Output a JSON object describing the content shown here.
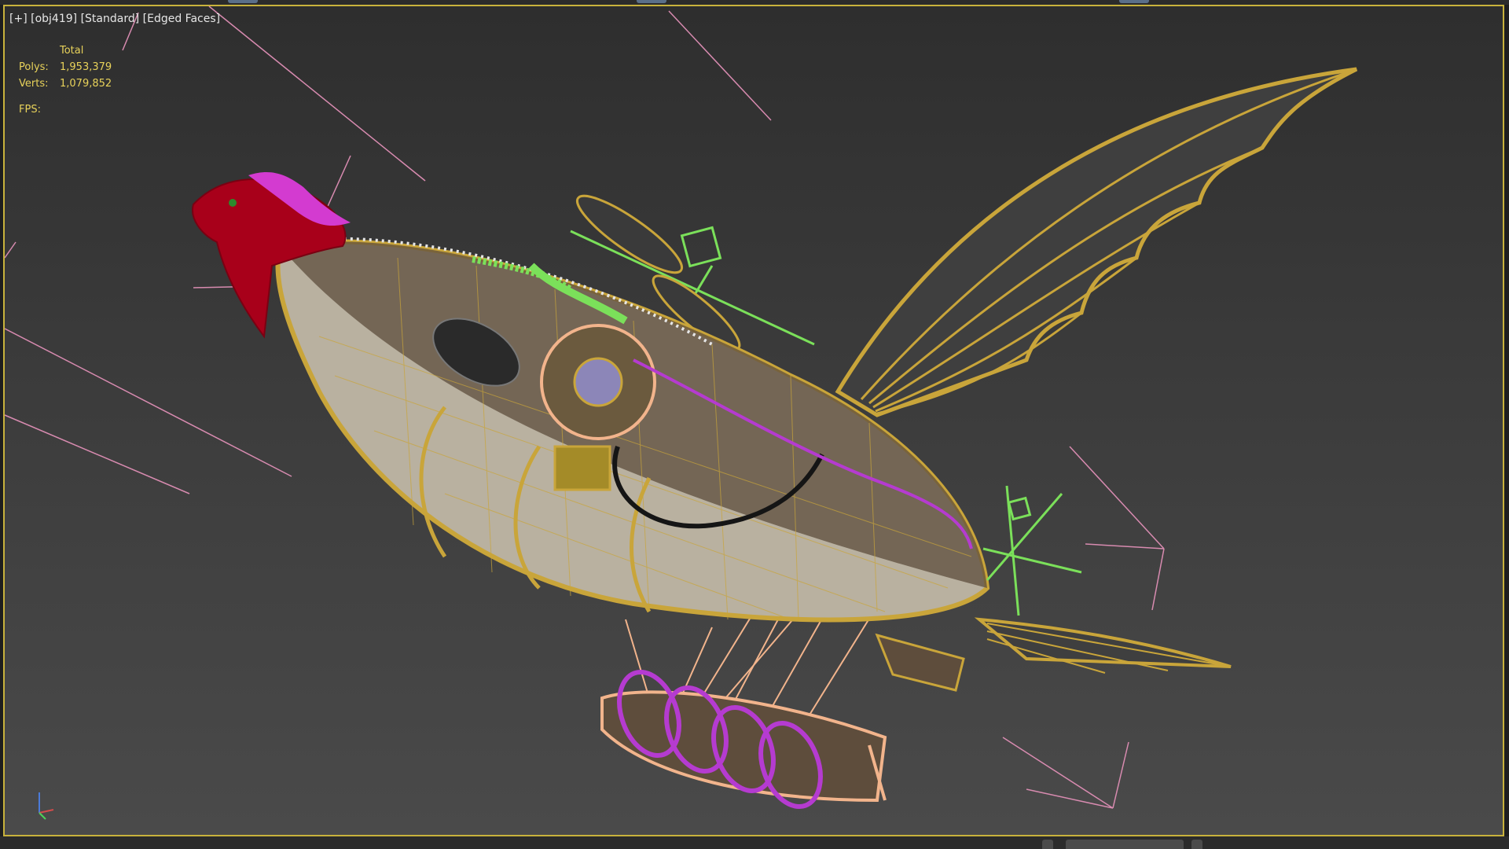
{
  "viewport": {
    "label": {
      "menu": "[+]",
      "view": "[obj419]",
      "shading": "[Standard]",
      "display": "[Edged Faces]"
    },
    "stats": {
      "header": "Total",
      "polys_label": "Polys:",
      "polys_value": "1,953,379",
      "verts_label": "Verts:",
      "verts_value": "1,079,852",
      "fps_label": "FPS:",
      "fps_value": ""
    },
    "axis_gizmo": {
      "x": "x",
      "y": "y",
      "z": "z"
    }
  },
  "colors": {
    "viewport_border": "#c8b23c",
    "stats_text": "#e8d25a",
    "wire_gold": "#c9a53a",
    "wire_peach": "#f2b48c",
    "wire_green": "#7be05a",
    "wire_magenta": "#b53bd0",
    "head_red": "#a8001a",
    "guide_pink": "#d88bb0"
  },
  "icons": [
    "viewport-menu-icon",
    "axis-gizmo-icon"
  ]
}
